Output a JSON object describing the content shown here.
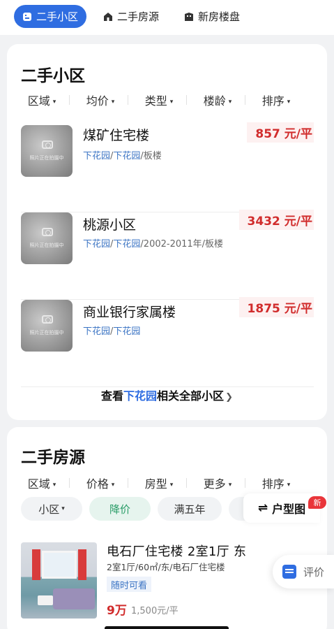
{
  "topnav": {
    "tabs": [
      {
        "label": "二手小区",
        "icon": "building-icon",
        "active": true
      },
      {
        "label": "二手房源",
        "icon": "home-icon",
        "active": false
      },
      {
        "label": "新房楼盘",
        "icon": "new-building-icon",
        "active": false
      }
    ]
  },
  "communities": {
    "title": "二手小区",
    "filters": [
      "区域",
      "均价",
      "类型",
      "楼龄",
      "排序"
    ],
    "items": [
      {
        "name": "煤矿住宅楼",
        "price": "857",
        "unit": "元/平",
        "area1": "下花园",
        "area2": "下花园",
        "extra": "/板楼",
        "placeholder": "照片正在拍摄中"
      },
      {
        "name": "桃源小区",
        "price": "3432",
        "unit": "元/平",
        "area1": "下花园",
        "area2": "下花园",
        "extra": "/2002-2011年/板楼",
        "placeholder": "照片正在拍摄中"
      },
      {
        "name": "商业银行家属楼",
        "price": "1875",
        "unit": "元/平",
        "area1": "下花园",
        "area2": "下花园",
        "extra": "",
        "placeholder": "照片正在拍摄中"
      }
    ],
    "view_all": {
      "prefix": "查看",
      "highlight": "下花园",
      "suffix": "相关全部小区"
    }
  },
  "listings": {
    "title": "二手房源",
    "filters": [
      "区域",
      "价格",
      "房型",
      "更多",
      "排序"
    ],
    "chips": [
      {
        "label": "小区",
        "active": false,
        "has_caret": true
      },
      {
        "label": "降价",
        "active": true,
        "has_caret": false
      },
      {
        "label": "满五年",
        "active": false,
        "has_caret": false
      },
      {
        "label": "满",
        "active": false,
        "has_caret": false
      }
    ],
    "layout_button": "户型图",
    "new_badge": "新",
    "item": {
      "title": "电石厂住宅楼 2室1厅 东",
      "meta": "2室1厅/60㎡/东/电石厂住宅楼",
      "tag": "随时可看",
      "price": "9万",
      "unit_price": "1,500元/平"
    }
  },
  "review_button": "评价",
  "colors": {
    "accent": "#2f6de1",
    "price_red": "#d12c2c",
    "chip_green": "#2a9d68"
  }
}
